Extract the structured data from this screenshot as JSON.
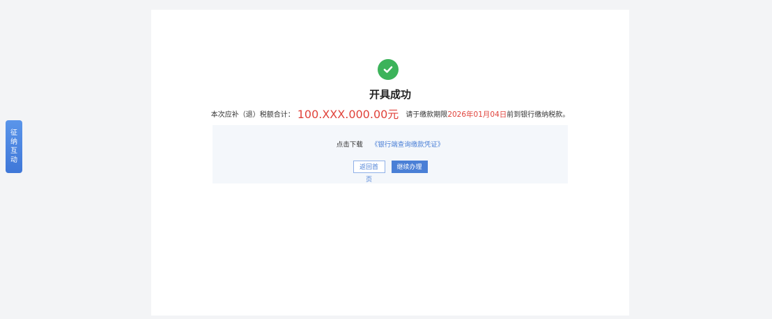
{
  "side_tab": {
    "chars": [
      "征",
      "纳",
      "互",
      "动"
    ]
  },
  "result": {
    "icon": "check-circle-icon",
    "title": "开具成功",
    "summary_prefix": "本次应补（退）税额合计：",
    "amount": "100.XXX.000.00元",
    "summary_mid": "请于缴款期限",
    "deadline": "2026年01月04日",
    "summary_suffix": "前到银行缴纳税款。"
  },
  "panel": {
    "download_label": "点击下载",
    "download_link": "《银行端查询缴款凭证》",
    "back_button": "返回首页",
    "continue_button": "继续办理"
  },
  "colors": {
    "success": "#3cb35a",
    "highlight": "#e0423a",
    "accent": "#4a7fd6"
  }
}
